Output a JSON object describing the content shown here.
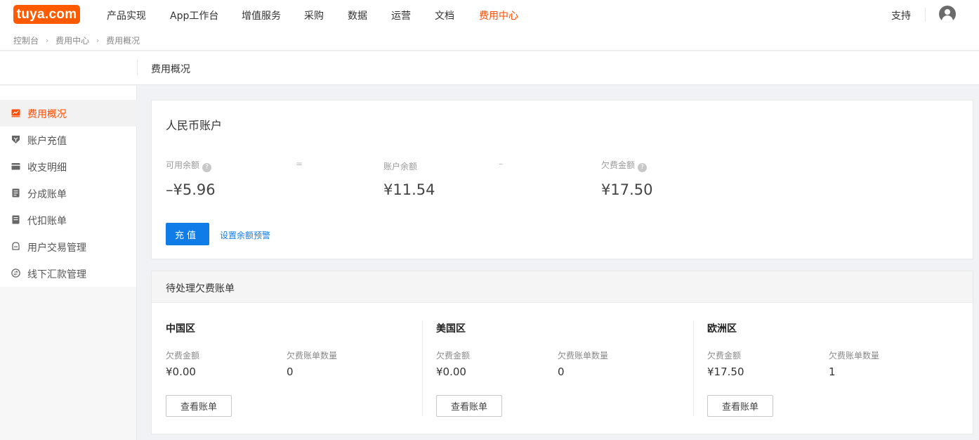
{
  "brand": {
    "logo_text": "tuya.com",
    "color": "#ff5a00"
  },
  "topnav": {
    "items": [
      {
        "label": "产品实现"
      },
      {
        "label": "App工作台"
      },
      {
        "label": "增值服务"
      },
      {
        "label": "采购"
      },
      {
        "label": "数据"
      },
      {
        "label": "运营"
      },
      {
        "label": "文档"
      },
      {
        "label": "费用中心",
        "active": true
      }
    ],
    "support_label": "支持",
    "avatar_icon": "user-avatar-icon"
  },
  "breadcrumb": [
    "控制台",
    "费用中心",
    "费用概况"
  ],
  "page_title": "费用概况",
  "sidebar": {
    "items": [
      {
        "label": "费用概况",
        "icon": "chart-icon",
        "active": true
      },
      {
        "label": "账户充值",
        "icon": "recharge-icon"
      },
      {
        "label": "收支明细",
        "icon": "wallet-icon"
      },
      {
        "label": "分成账单",
        "icon": "bill-icon"
      },
      {
        "label": "代扣账单",
        "icon": "deduction-icon"
      },
      {
        "label": "用户交易管理",
        "icon": "transaction-icon"
      },
      {
        "label": "线下汇款管理",
        "icon": "remittance-icon"
      }
    ]
  },
  "account": {
    "title": "人民币账户",
    "available_label": "可用余额",
    "available_value": "–¥5.96",
    "equals": "=",
    "balance_label": "账户余额",
    "balance_value": "¥11.54",
    "minus": "–",
    "arrears_label": "欠费金额",
    "arrears_value": "¥17.50",
    "recharge_button": "充值",
    "alert_link": "设置余额预警"
  },
  "pending": {
    "title": "待处理欠费账单",
    "amount_label": "欠费金额",
    "count_label": "欠费账单数量",
    "view_button": "查看账单",
    "regions": [
      {
        "name": "中国区",
        "amount": "¥0.00",
        "count": "0"
      },
      {
        "name": "美国区",
        "amount": "¥0.00",
        "count": "0"
      },
      {
        "name": "欧洲区",
        "amount": "¥17.50",
        "count": "1"
      }
    ]
  },
  "colors": {
    "accent": "#ff4b00",
    "primary": "#0f7ce8",
    "background": "#f0f2f5"
  }
}
